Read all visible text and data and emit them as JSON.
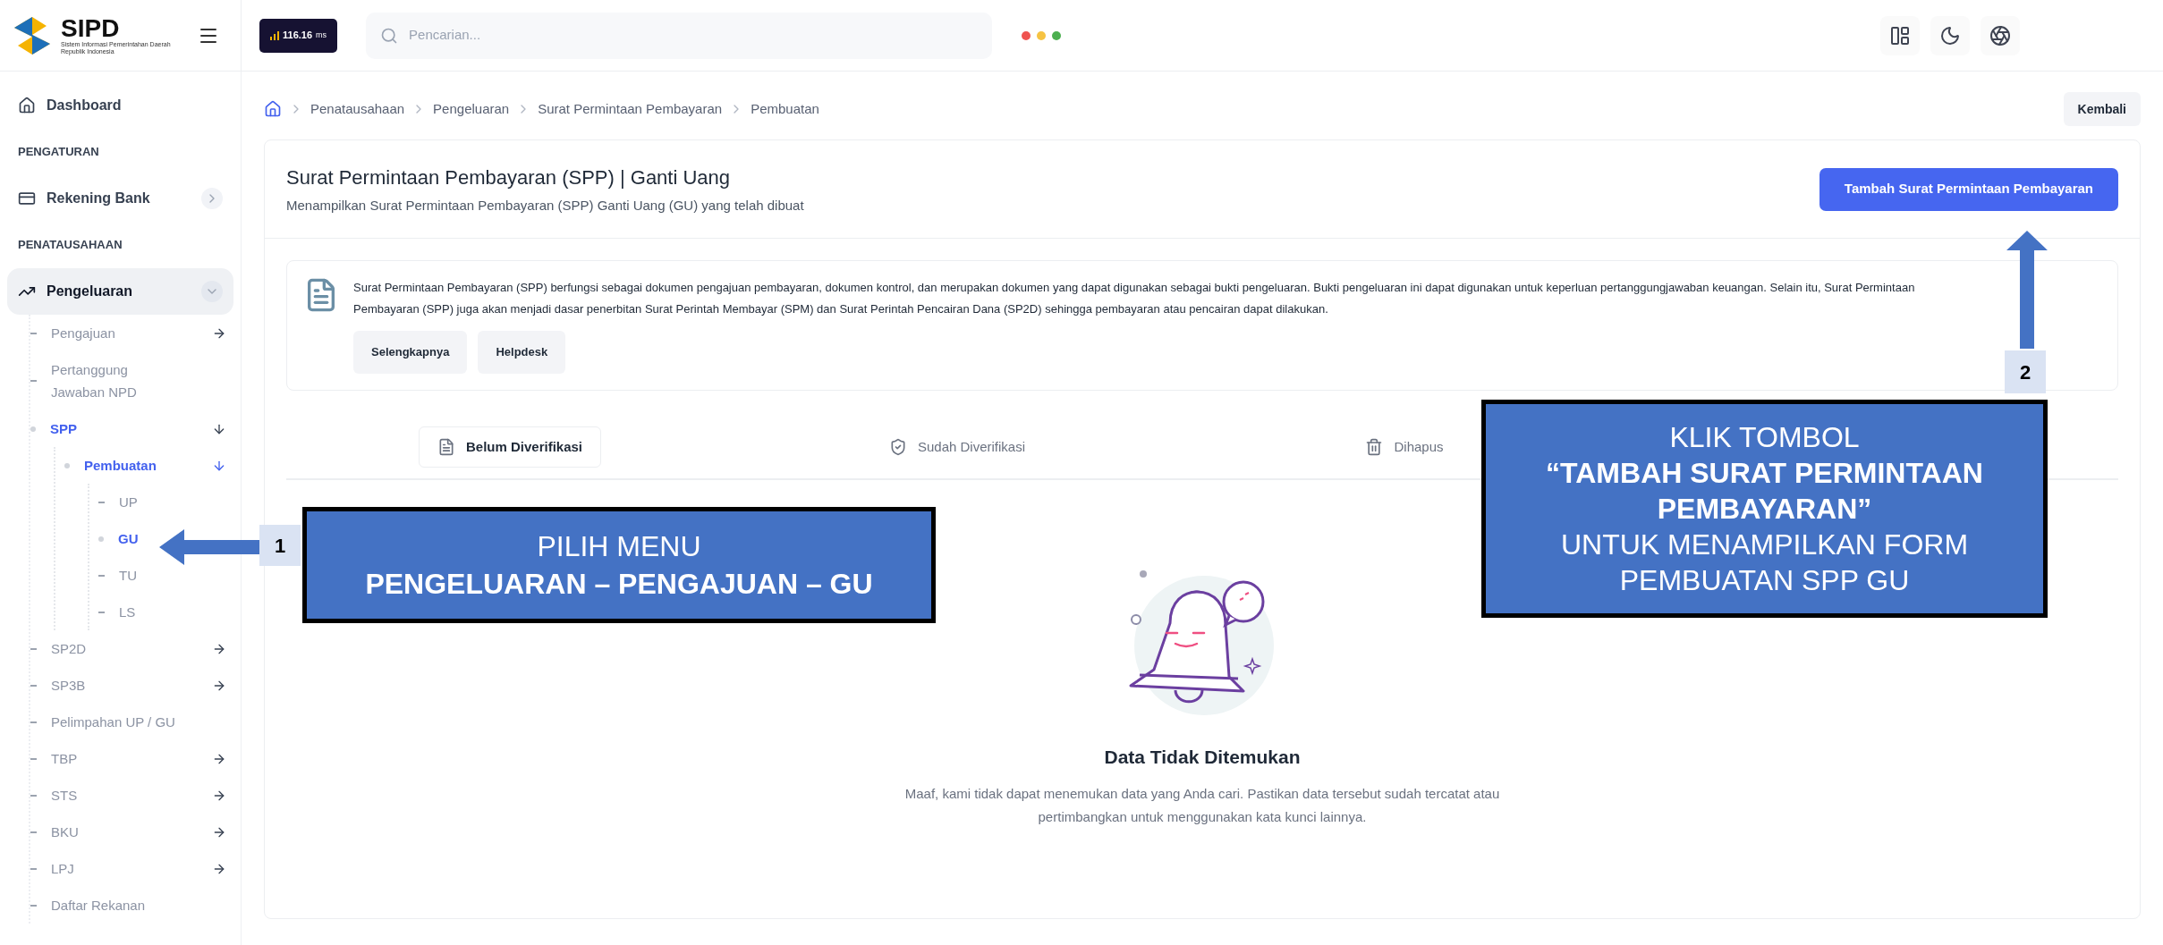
{
  "header": {
    "logo": "SIPD",
    "logo_subtitle": "Sistem Informasi Pemerintahan Daerah Republik Indonesia",
    "latency": "116.16",
    "latency_unit": "ms",
    "search": {
      "placeholder": "Pencarian..."
    }
  },
  "sidebar": {
    "items": [
      {
        "kind": "link",
        "label": "Dashboard",
        "selected": false
      },
      {
        "kind": "section",
        "label": "PENGATURAN"
      },
      {
        "kind": "link",
        "label": "Rekening Bank",
        "selected": false,
        "expanded": false
      },
      {
        "kind": "section",
        "label": "PENATAUSAHAAN"
      },
      {
        "kind": "link",
        "label": "Pengeluaran",
        "selected": true,
        "expanded": true,
        "children": [
          {
            "label": "Pengajuan",
            "selected": false,
            "expanded": false
          },
          {
            "label": "Pertanggung Jawaban NPD",
            "selected": false
          },
          {
            "label": "SPP",
            "selected": true,
            "expanded": true,
            "children": [
              {
                "label": "Pembuatan",
                "selected": true,
                "expanded": true,
                "children": [
                  {
                    "label": "UP",
                    "selected": false
                  },
                  {
                    "label": "GU",
                    "selected": true
                  },
                  {
                    "label": "TU",
                    "selected": false
                  },
                  {
                    "label": "LS",
                    "selected": false
                  }
                ]
              }
            ]
          },
          {
            "label": "SP2D",
            "selected": false,
            "expanded": false
          },
          {
            "label": "SP3B",
            "selected": false,
            "expanded": false
          },
          {
            "label": "Pelimpahan UP / GU",
            "selected": false
          },
          {
            "label": "TBP",
            "selected": false,
            "expanded": false
          },
          {
            "label": "STS",
            "selected": false,
            "expanded": false
          },
          {
            "label": "BKU",
            "selected": false,
            "expanded": false
          },
          {
            "label": "LPJ",
            "selected": false,
            "expanded": false
          },
          {
            "label": "Daftar Rekanan",
            "selected": false
          }
        ]
      }
    ]
  },
  "breadcrumb": [
    "Penatausahaan",
    "Pengeluaran",
    "Surat Permintaan Pembayaran",
    "Pembuatan"
  ],
  "back_button": "Kembali",
  "card": {
    "title": "Surat Permintaan Pembayaran (SPP) | Ganti Uang",
    "subtitle": "Menampilkan Surat Permintaan Pembayaran (SPP) Ganti Uang (GU) yang telah dibuat",
    "add_button": "Tambah Surat Permintaan Pembayaran",
    "info": {
      "text": "Surat Permintaan Pembayaran (SPP) berfungsi sebagai dokumen pengajuan pembayaran, dokumen kontrol, dan merupakan dokumen yang dapat digunakan sebagai bukti pengeluaran. Bukti pengeluaran ini dapat digunakan untuk keperluan pertanggungjawaban keuangan. Selain itu, Surat Permintaan Pembayaran (SPP) juga akan menjadi dasar penerbitan Surat Perintah Membayar (SPM) dan Surat Perintah Pencairan Dana (SP2D) sehingga pembayaran atau pencairan dapat dilakukan.",
      "buttons": [
        "Selengkapnya",
        "Helpdesk"
      ]
    },
    "tabs": [
      {
        "label": "Belum Diverifikasi",
        "selected": true
      },
      {
        "label": "Sudah Diverifikasi",
        "selected": false
      },
      {
        "label": "Dihapus",
        "selected": false
      }
    ],
    "empty": {
      "title": "Data Tidak Ditemukan",
      "text": "Maaf, kami tidak dapat menemukan data yang Anda cari. Pastikan data tersebut sudah tercatat atau pertimbangkan untuk menggunakan kata kunci lainnya."
    }
  },
  "callouts": [
    {
      "number": "1",
      "lines": [
        "PILIH MENU",
        "**PENGELUARAN – PENGAJUAN – GU**"
      ]
    },
    {
      "number": "2",
      "lines": [
        "KLIK TOMBOL",
        "**“TAMBAH SURAT PERMINTAAN PEMBAYARAN”**",
        "UNTUK MENAMPILKAN FORM PEMBUATAN SPP GU"
      ]
    }
  ]
}
